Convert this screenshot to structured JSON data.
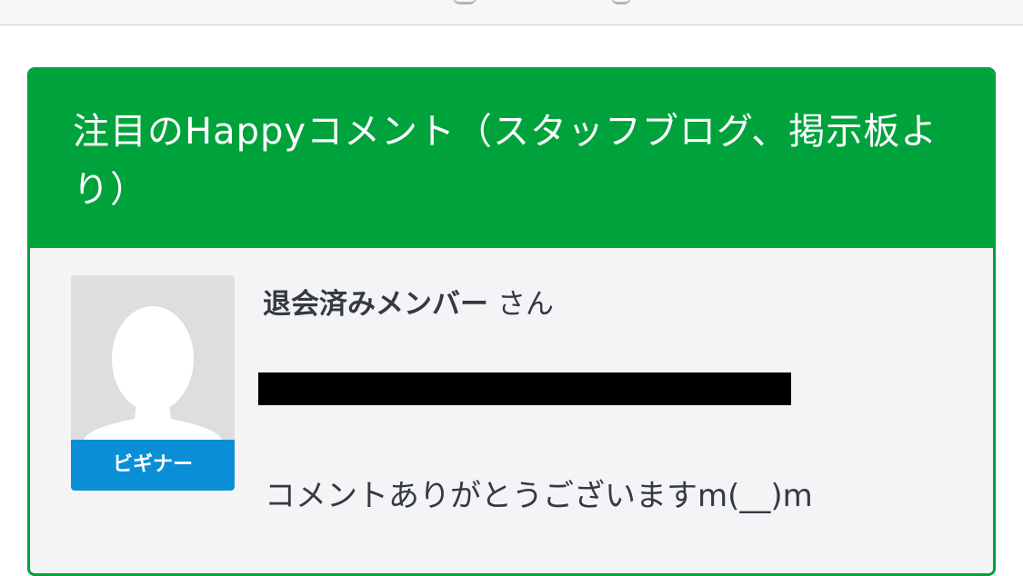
{
  "card": {
    "title": "注目のHappyコメント（スタッフブログ、掲示板より）"
  },
  "comment": {
    "author_name": "退会済みメンバー",
    "author_suffix": "さん",
    "level_badge": "ビギナー",
    "avatar_icon": "default-user-silhouette-icon",
    "text": "コメントありがとうございますm(__)m"
  },
  "colors": {
    "header_green": "#00a23c",
    "badge_blue": "#0a8fd6",
    "card_background": "#f4f4f6",
    "text_dark": "#333a42"
  }
}
